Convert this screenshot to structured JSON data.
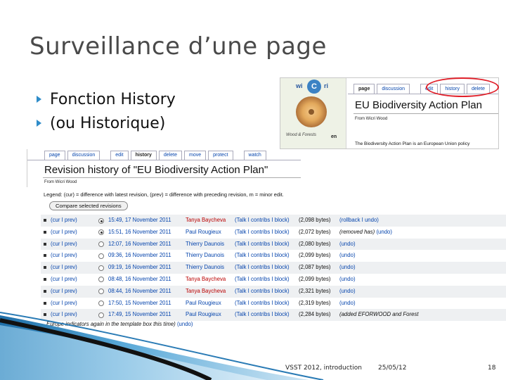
{
  "slide": {
    "title": "Surveillance d’une page",
    "bullets": [
      "Fonction History",
      "(ou Historique)"
    ]
  },
  "article": {
    "logo": {
      "left": "wi",
      "middle": "C",
      "right": "ri",
      "caption": "Wood & Forests",
      "lang": "en"
    },
    "tabs": [
      "page",
      "discussion",
      "edit",
      "history",
      "delete"
    ],
    "title": "EU Biodiversity Action Plan",
    "from": "From Wicri Wood",
    "body": "The Biodiversity Action Plan is an European Union policy"
  },
  "history": {
    "tabs": [
      "page",
      "discussion",
      "edit",
      "history",
      "delete",
      "move",
      "protect",
      "watch"
    ],
    "title": "Revision history of \"EU Biodiversity Action Plan\"",
    "from": "From Wicri Wood",
    "legend": "Legend: (cur) = difference with latest revision, (prev) = difference with preceding revision, m = minor edit.",
    "compare_button": "Compare selected revisions",
    "rows": [
      {
        "cur_prev": "(cur I prev)",
        "date": "15:49, 17 November 2011",
        "user": "Tanya Baycheva",
        "user_color": "red",
        "talk": "(Talk I contribs I block)",
        "size": "(2,098 bytes)",
        "extra": "(rollback I undo)",
        "extra_note": "",
        "selected": true
      },
      {
        "cur_prev": "(cur I prev)",
        "date": "15:51, 16 November 2011",
        "user": "Paul Rougieux",
        "user_color": "blue",
        "talk": "(Talk I contribs I block)",
        "size": "(2,072 bytes)",
        "extra": "(undo)",
        "extra_note": "(removed has)",
        "selected": true
      },
      {
        "cur_prev": "(cur I prev)",
        "date": "12:07, 16 November 2011",
        "user": "Thierry Daunois",
        "user_color": "blue",
        "talk": "(Talk I contribs I block)",
        "size": "(2,080 bytes)",
        "extra": "(undo)",
        "extra_note": "",
        "selected": false
      },
      {
        "cur_prev": "(cur I prev)",
        "date": "09:36, 16 November 2011",
        "user": "Thierry Daunois",
        "user_color": "blue",
        "talk": "(Talk I contribs I block)",
        "size": "(2,099 bytes)",
        "extra": "(undo)",
        "extra_note": "",
        "selected": false
      },
      {
        "cur_prev": "(cur I prev)",
        "date": "09:19, 16 November 2011",
        "user": "Thierry Daunois",
        "user_color": "blue",
        "talk": "(Talk I contribs I block)",
        "size": "(2,087 bytes)",
        "extra": "(undo)",
        "extra_note": "",
        "selected": false
      },
      {
        "cur_prev": "(cur I prev)",
        "date": "08:48, 16 November 2011",
        "user": "Tanya Baycheva",
        "user_color": "red",
        "talk": "(Talk I contribs I block)",
        "size": "(2,099 bytes)",
        "extra": "(undo)",
        "extra_note": "",
        "selected": false
      },
      {
        "cur_prev": "(cur I prev)",
        "date": "08:44, 16 November 2011",
        "user": "Tanya Baycheva",
        "user_color": "red",
        "talk": "(Talk I contribs I block)",
        "size": "(2,321 bytes)",
        "extra": "(undo)",
        "extra_note": "",
        "selected": false
      },
      {
        "cur_prev": "(cur I prev)",
        "date": "17:50, 15 November 2011",
        "user": "Paul Rougieux",
        "user_color": "blue",
        "talk": "(Talk I contribs I block)",
        "size": "(2,319 bytes)",
        "extra": "(undo)",
        "extra_note": "",
        "selected": false
      },
      {
        "cur_prev": "(cur I prev)",
        "date": "17:49, 15 November 2011",
        "user": "Paul Rougieux",
        "user_color": "blue",
        "talk": "(Talk I contribs I block)",
        "size": "(2,284 bytes)",
        "extra": "",
        "extra_note": "(added EFORWOOD and Forest",
        "selected": false
      }
    ],
    "continuation": "Europe indicators again in the template box this time)",
    "continuation_link": "(undo)"
  },
  "footer": {
    "text": "VSST 2012, introduction",
    "date": "25/05/12",
    "page": "18"
  },
  "colors": {
    "accent": "#2e8cc9",
    "highlight_oval": "#e0202a",
    "link": "#0645ad",
    "redlink": "#ba0000"
  }
}
